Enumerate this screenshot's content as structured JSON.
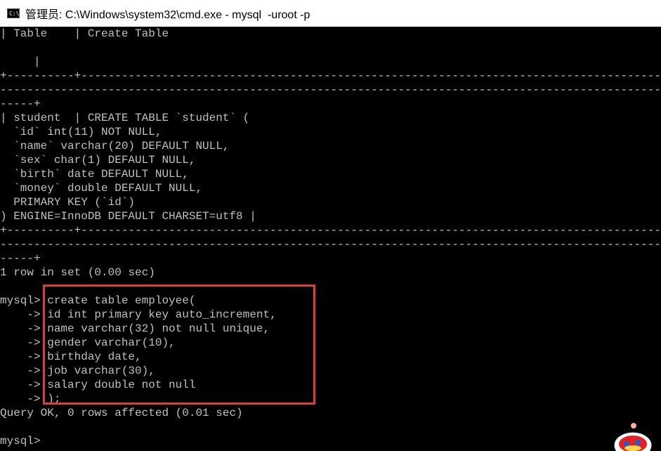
{
  "window": {
    "icon_text": "C:\\.",
    "title": "管理员: C:\\Windows\\system32\\cmd.exe - mysql  -uroot -p"
  },
  "console": {
    "lines": [
      "| Table    | Create Table",
      "",
      "     |",
      "+----------+--------------------------------------------------------------------------------------------",
      "----------------------------------------------------------------------------------------------------------",
      "-----+",
      "| student  | CREATE TABLE `student` (",
      "  `id` int(11) NOT NULL,",
      "  `name` varchar(20) DEFAULT NULL,",
      "  `sex` char(1) DEFAULT NULL,",
      "  `birth` date DEFAULT NULL,",
      "  `money` double DEFAULT NULL,",
      "  PRIMARY KEY (`id`)",
      ") ENGINE=InnoDB DEFAULT CHARSET=utf8 |",
      "+----------+--------------------------------------------------------------------------------------------",
      "----------------------------------------------------------------------------------------------------------",
      "-----+",
      "1 row in set (0.00 sec)",
      "",
      "mysql> create table employee(",
      "    -> id int primary key auto_increment,",
      "    -> name varchar(32) not null unique,",
      "    -> gender varchar(10),",
      "    -> birthday date,",
      "    -> job varchar(30),",
      "    -> salary double not null",
      "    -> );",
      "Query OK, 0 rows affected (0.01 sec)",
      "",
      "mysql>"
    ]
  },
  "colors": {
    "background": "#000000",
    "text": "#c0c0c0",
    "highlight_border": "#e03c3c"
  }
}
